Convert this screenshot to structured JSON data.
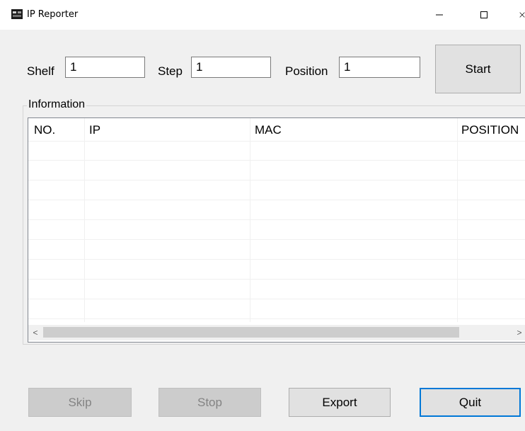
{
  "window": {
    "title": "IP Reporter",
    "minimize_glyph": "—",
    "maximize_glyph": "☐",
    "close_glyph": "✕"
  },
  "form": {
    "shelf_label": "Shelf",
    "shelf_value": "1",
    "step_label": "Step",
    "step_value": "1",
    "position_label": "Position",
    "position_value": "1",
    "start_label": "Start"
  },
  "information": {
    "group_label": "Information",
    "columns": [
      "NO.",
      "IP",
      "MAC",
      "POSITION"
    ],
    "rows": []
  },
  "scrollbar": {
    "left_arrow": "<",
    "right_arrow": ">"
  },
  "buttons": {
    "skip_label": "Skip",
    "stop_label": "Stop",
    "export_label": "Export",
    "quit_label": "Quit"
  },
  "colors": {
    "focus_border": "#0078d7",
    "window_background": "#f0f0f0"
  }
}
